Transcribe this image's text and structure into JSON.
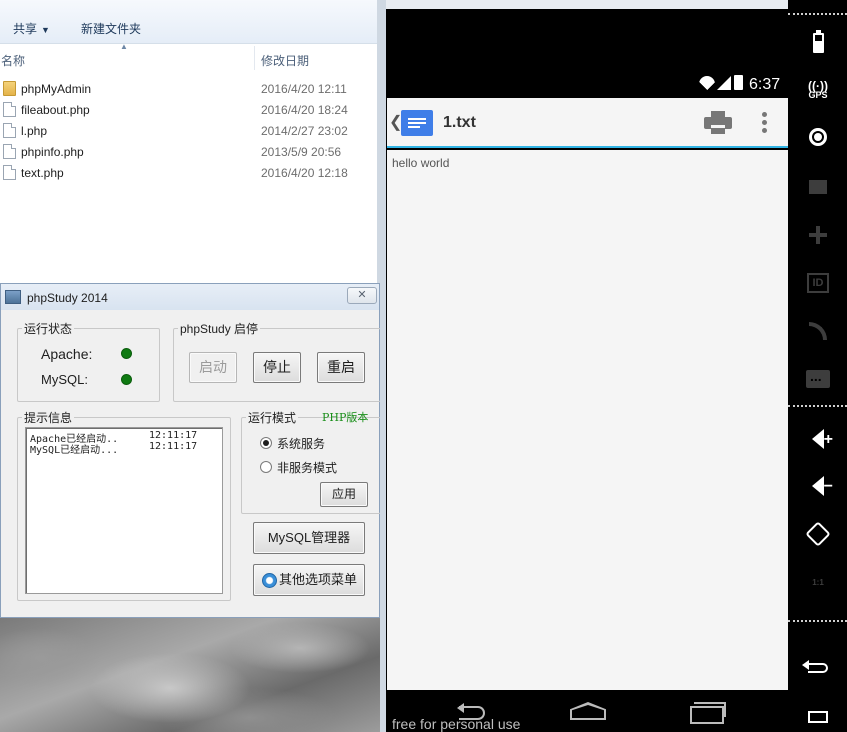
{
  "explorer": {
    "toolbar": {
      "share_label": "共享",
      "share_caret": "▼",
      "new_folder_label": "新建文件夹"
    },
    "columns": {
      "name": "名称",
      "modified": "修改日期"
    },
    "files": [
      {
        "name": "phpMyAdmin",
        "date": "2016/4/20 12:11",
        "icon": "folder-icon"
      },
      {
        "name": "fileabout.php",
        "date": "2016/4/20 18:24",
        "icon": "file-icon"
      },
      {
        "name": "l.php",
        "date": "2014/2/27 23:02",
        "icon": "file-icon"
      },
      {
        "name": "phpinfo.php",
        "date": "2013/5/9 20:56",
        "icon": "file-icon"
      },
      {
        "name": "text.php",
        "date": "2016/4/20 12:18",
        "icon": "file-icon"
      }
    ]
  },
  "phpstudy": {
    "title": "phpStudy 2014",
    "close_label": "✕",
    "status_group": {
      "legend": "运行状态",
      "apache_label": "Apache:",
      "mysql_label": "MySQL:",
      "apache_running": true,
      "mysql_running": true,
      "led_color": "#0f7a12"
    },
    "control_group": {
      "legend": "phpStudy 启停",
      "start": "启动",
      "stop": "停止",
      "restart": "重启"
    },
    "info_group": {
      "legend": "提示信息",
      "log": [
        {
          "msg": "Apache已经启动..",
          "time": "12:11:17"
        },
        {
          "msg": "MySQL已经启动...",
          "time": "12:11:17"
        }
      ]
    },
    "mode_group": {
      "legend": "运行模式",
      "php_version_link": "PHP版本",
      "system_service": "系统服务",
      "non_service": "非服务模式",
      "selected": "system_service",
      "apply": "应用"
    },
    "mysql_manager": "MySQL管理器",
    "other_menu": "其他选项菜单"
  },
  "emulator": {
    "status_time": "6:37",
    "app_title": "1.txt",
    "file_content": "hello world",
    "watermark": "free for personal use",
    "accent_color": "#33b5e5",
    "side_gps_label": "GPS",
    "side_id_label": "ID",
    "side_scale_label": "1:1"
  }
}
